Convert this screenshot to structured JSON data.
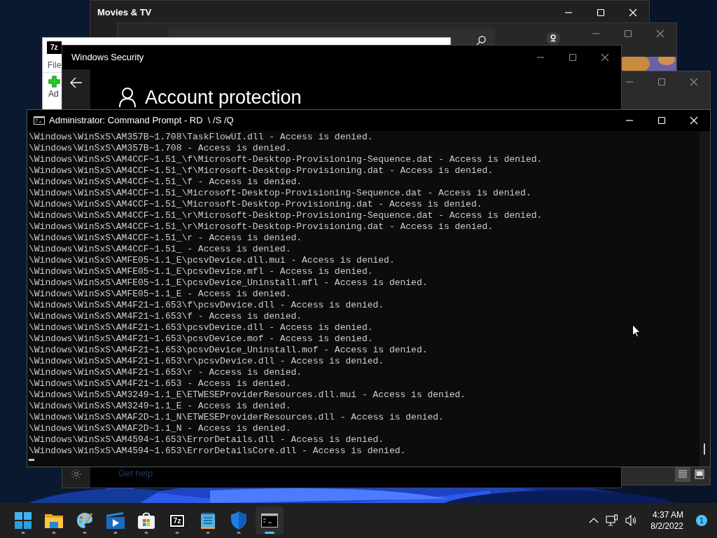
{
  "movies_window": {
    "title": "Movies & TV"
  },
  "sevenzip_window": {
    "logo": "7z",
    "menu": "File",
    "toolbar_button": "Ad"
  },
  "security_window": {
    "title": "Windows Security",
    "heading": "Account protection",
    "help_link": "Get help"
  },
  "cmd_window": {
    "title": "Administrator: Command Prompt - RD  \\ /S /Q",
    "lines": [
      "\\Windows\\WinSxS\\AM357B~1.708\\TaskFlowUI.dll - Access is denied.",
      "\\Windows\\WinSxS\\AM357B~1.708 - Access is denied.",
      "\\Windows\\WinSxS\\AM4CCF~1.51_\\f\\Microsoft-Desktop-Provisioning-Sequence.dat - Access is denied.",
      "\\Windows\\WinSxS\\AM4CCF~1.51_\\f\\Microsoft-Desktop-Provisioning.dat - Access is denied.",
      "\\Windows\\WinSxS\\AM4CCF~1.51_\\f - Access is denied.",
      "\\Windows\\WinSxS\\AM4CCF~1.51_\\Microsoft-Desktop-Provisioning-Sequence.dat - Access is denied.",
      "\\Windows\\WinSxS\\AM4CCF~1.51_\\Microsoft-Desktop-Provisioning.dat - Access is denied.",
      "\\Windows\\WinSxS\\AM4CCF~1.51_\\r\\Microsoft-Desktop-Provisioning-Sequence.dat - Access is denied.",
      "\\Windows\\WinSxS\\AM4CCF~1.51_\\r\\Microsoft-Desktop-Provisioning.dat - Access is denied.",
      "\\Windows\\WinSxS\\AM4CCF~1.51_\\r - Access is denied.",
      "\\Windows\\WinSxS\\AM4CCF~1.51_ - Access is denied.",
      "\\Windows\\WinSxS\\AMFE05~1.1_E\\pcsvDevice.dll.mui - Access is denied.",
      "\\Windows\\WinSxS\\AMFE05~1.1_E\\pcsvDevice.mfl - Access is denied.",
      "\\Windows\\WinSxS\\AMFE05~1.1_E\\pcsvDevice_Uninstall.mfl - Access is denied.",
      "\\Windows\\WinSxS\\AMFE05~1.1_E - Access is denied.",
      "\\Windows\\WinSxS\\AM4F21~1.653\\f\\pcsvDevice.dll - Access is denied.",
      "\\Windows\\WinSxS\\AM4F21~1.653\\f - Access is denied.",
      "\\Windows\\WinSxS\\AM4F21~1.653\\pcsvDevice.dll - Access is denied.",
      "\\Windows\\WinSxS\\AM4F21~1.653\\pcsvDevice.mof - Access is denied.",
      "\\Windows\\WinSxS\\AM4F21~1.653\\pcsvDevice_Uninstall.mof - Access is denied.",
      "\\Windows\\WinSxS\\AM4F21~1.653\\r\\pcsvDevice.dll - Access is denied.",
      "\\Windows\\WinSxS\\AM4F21~1.653\\r - Access is denied.",
      "\\Windows\\WinSxS\\AM4F21~1.653 - Access is denied.",
      "\\Windows\\WinSxS\\AM3249~1.1_E\\ETWESEProviderResources.dll.mui - Access is denied.",
      "\\Windows\\WinSxS\\AM3249~1.1_E - Access is denied.",
      "\\Windows\\WinSxS\\AMAF2D~1.1_N\\ETWESEProviderResources.dll - Access is denied.",
      "\\Windows\\WinSxS\\AMAF2D~1.1_N - Access is denied.",
      "\\Windows\\WinSxS\\AM4594~1.653\\ErrorDetails.dll - Access is denied.",
      "\\Windows\\WinSxS\\AM4594~1.653\\ErrorDetailsCore.dll - Access is denied."
    ]
  },
  "taskbar": {
    "items": [
      {
        "kind": "start",
        "selected": false
      },
      {
        "kind": "folder",
        "selected": false
      },
      {
        "kind": "paint",
        "selected": false
      },
      {
        "kind": "video",
        "selected": false
      },
      {
        "kind": "store",
        "selected": false
      },
      {
        "kind": "sevenzip",
        "label": "7z",
        "selected": false
      },
      {
        "kind": "notepad",
        "selected": false
      },
      {
        "kind": "shield",
        "selected": false
      },
      {
        "kind": "terminal",
        "selected": true
      }
    ],
    "time": "4:37 AM",
    "date": "8/2/2022",
    "notification_count": "1"
  }
}
